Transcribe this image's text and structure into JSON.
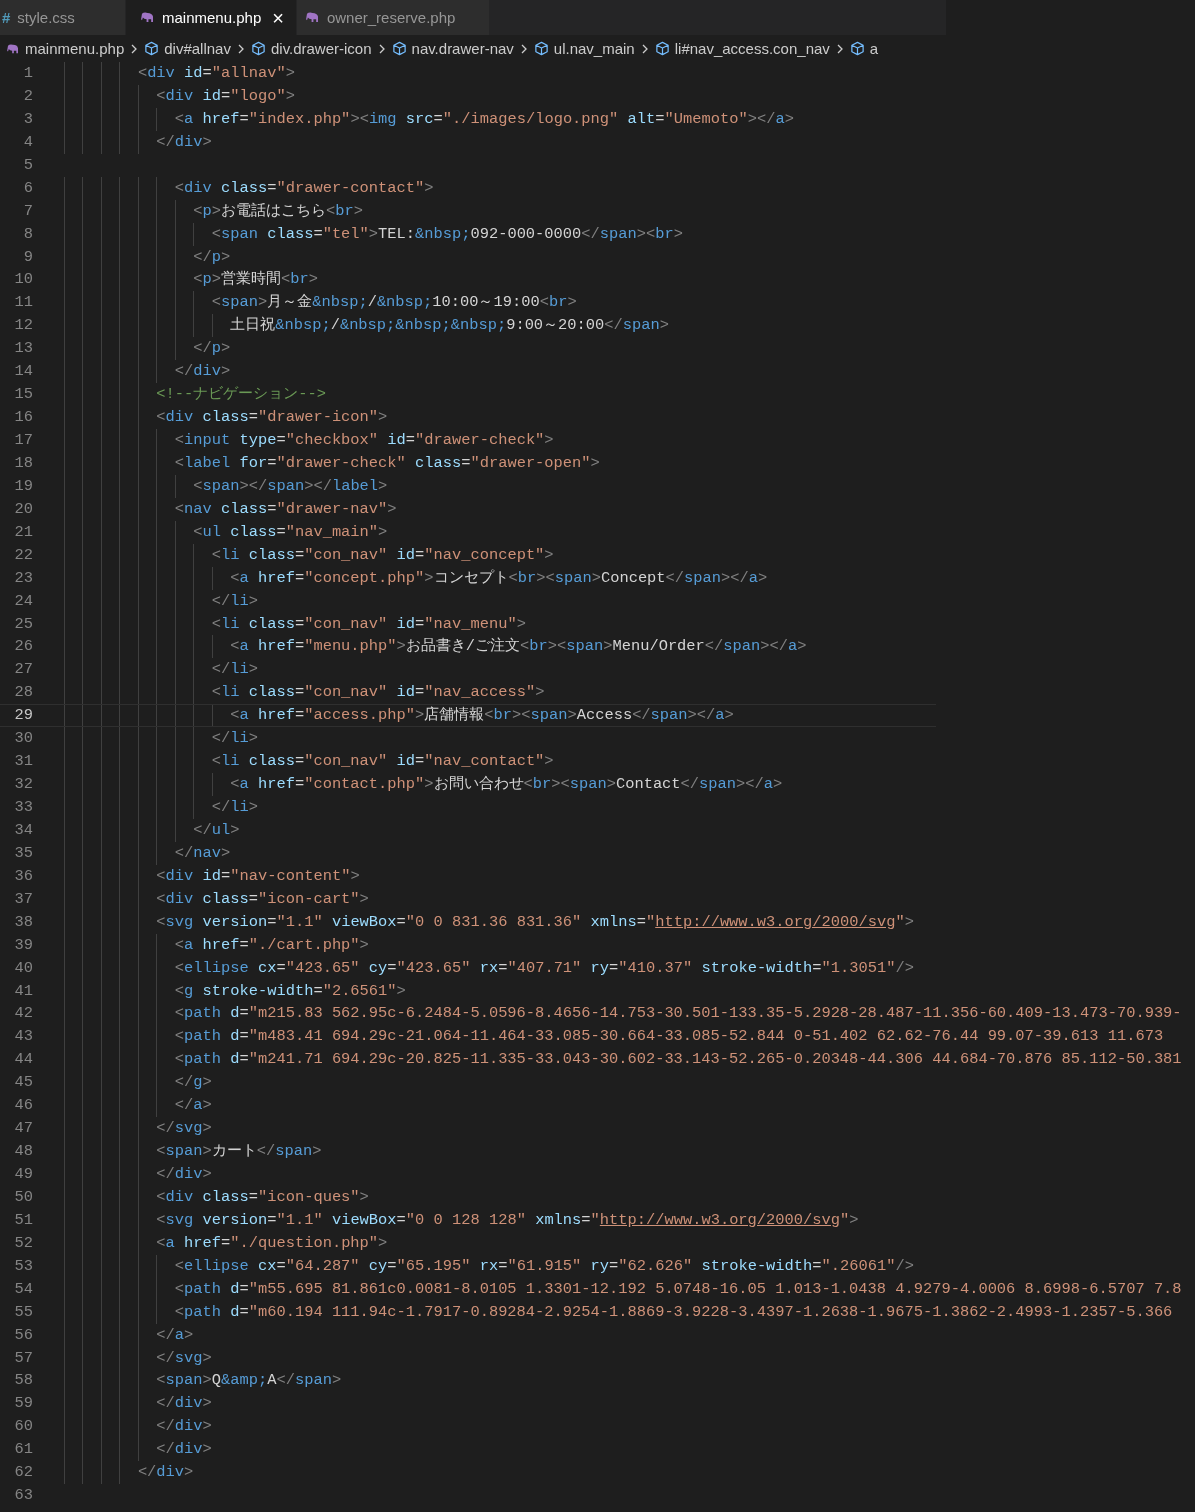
{
  "tabs": [
    {
      "label": "style.css",
      "kind": "css",
      "icon": "#",
      "selected": false
    },
    {
      "label": "mainmenu.php",
      "kind": "php",
      "selected": true,
      "close": "×"
    },
    {
      "label": "owner_reserve.php",
      "kind": "php",
      "selected": false
    }
  ],
  "breadcrumbs": [
    {
      "label": "mainmenu.php",
      "kind": "file"
    },
    {
      "label": "div#allnav",
      "kind": "element"
    },
    {
      "label": "div.drawer-icon",
      "kind": "element"
    },
    {
      "label": "nav.drawer-nav",
      "kind": "element"
    },
    {
      "label": "ul.nav_main",
      "kind": "element"
    },
    {
      "label": "li#nav_access.con_nav",
      "kind": "element"
    },
    {
      "label": "a",
      "kind": "element"
    }
  ],
  "lines": [
    {
      "number": "1",
      "current": false,
      "code": "        <div id=\"allnav\">"
    },
    {
      "number": "2",
      "current": false,
      "code": "          <div id=\"logo\">"
    },
    {
      "number": "3",
      "current": false,
      "code": "            <a href=\"index.php\"><img src=\"./images/logo.png\" alt=\"Umemoto\"></a>"
    },
    {
      "number": "4",
      "current": false,
      "code": "          </div>"
    },
    {
      "number": "5",
      "current": false
    },
    {
      "number": "6",
      "current": false,
      "code": "            <div class=\"drawer-contact\">"
    },
    {
      "number": "7",
      "current": false,
      "code": "              <p>お電話はこちら<br>"
    },
    {
      "number": "8",
      "current": false,
      "code": "                <span class=\"tel\">TEL:&nbsp;092-000-0000</span><br>"
    },
    {
      "number": "9",
      "current": false,
      "code": "              </p>"
    },
    {
      "number": "10",
      "current": false,
      "code": "              <p>営業時間<br>"
    },
    {
      "number": "11",
      "current": false,
      "code": "                <span>月～金&nbsp;/&nbsp;10:00～19:00<br>"
    },
    {
      "number": "12",
      "current": false,
      "code": "                  土日祝&nbsp;/&nbsp;&nbsp;&nbsp;9:00～20:00</span>"
    },
    {
      "number": "13",
      "current": false,
      "code": "              </p>"
    },
    {
      "number": "14",
      "current": false,
      "code": "            </div>"
    },
    {
      "number": "15",
      "current": false,
      "code": "          <!--ナビゲーション-->"
    },
    {
      "number": "16",
      "current": false,
      "code": "          <div class=\"drawer-icon\">"
    },
    {
      "number": "17",
      "current": false,
      "code": "            <input type=\"checkbox\" id=\"drawer-check\">"
    },
    {
      "number": "18",
      "current": false,
      "code": "            <label for=\"drawer-check\" class=\"drawer-open\">"
    },
    {
      "number": "19",
      "current": false,
      "code": "              <span></span></label>"
    },
    {
      "number": "20",
      "current": false,
      "code": "            <nav class=\"drawer-nav\">"
    },
    {
      "number": "21",
      "current": false,
      "code": "              <ul class=\"nav_main\">"
    },
    {
      "number": "22",
      "current": false,
      "code": "                <li class=\"con_nav\" id=\"nav_concept\">"
    },
    {
      "number": "23",
      "current": false,
      "code": "                  <a href=\"concept.php\">コンセプト<br><span>Concept</span></a>"
    },
    {
      "number": "24",
      "current": false,
      "code": "                </li>"
    },
    {
      "number": "25",
      "current": false,
      "code": "                <li class=\"con_nav\" id=\"nav_menu\">"
    },
    {
      "number": "26",
      "current": false,
      "code": "                  <a href=\"menu.php\">お品書き/ご注文<br><span>Menu/Order</span></a>"
    },
    {
      "number": "27",
      "current": false,
      "code": "                </li>"
    },
    {
      "number": "28",
      "current": false,
      "code": "                <li class=\"con_nav\" id=\"nav_access\">"
    },
    {
      "number": "29",
      "current": true,
      "code": "                  <a href=\"access.php\">店舗情報<br><span>Access</span></a>"
    },
    {
      "number": "30",
      "current": false,
      "code": "                </li>"
    },
    {
      "number": "31",
      "current": false,
      "code": "                <li class=\"con_nav\" id=\"nav_contact\">"
    },
    {
      "number": "32",
      "current": false,
      "code": "                  <a href=\"contact.php\">お問い合わせ<br><span>Contact</span></a>"
    },
    {
      "number": "33",
      "current": false,
      "code": "                </li>"
    },
    {
      "number": "34",
      "current": false,
      "code": "              </ul>"
    },
    {
      "number": "35",
      "current": false,
      "code": "            </nav>"
    },
    {
      "number": "36",
      "current": false,
      "code": "          <div id=\"nav-content\">"
    },
    {
      "number": "37",
      "current": false,
      "code": "          <div class=\"icon-cart\">"
    },
    {
      "number": "38",
      "current": false,
      "code": "          <svg version=\"1.1\" viewBox=\"0 0 831.36 831.36\" xmlns=\"http://www.w3.org/2000/svg\">"
    },
    {
      "number": "39",
      "current": false,
      "code": "            <a href=\"./cart.php\">"
    },
    {
      "number": "40",
      "current": false,
      "code": "            <ellipse cx=\"423.65\" cy=\"423.65\" rx=\"407.71\" ry=\"410.37\" stroke-width=\"1.3051\"/>"
    },
    {
      "number": "41",
      "current": false,
      "code": "            <g stroke-width=\"2.6561\">"
    },
    {
      "number": "42",
      "current": false,
      "code": "            <path d=\"m215.83 562.95c-6.2484-5.0596-8.4656-14.753-30.501-133.35-5.2928-28.487-11.356-60.409-13.473-70.939-"
    },
    {
      "number": "43",
      "current": false,
      "code": "            <path d=\"m483.41 694.29c-21.064-11.464-33.085-30.664-33.085-52.844 0-51.402 62.62-76.44 99.07-39.613 11.673"
    },
    {
      "number": "44",
      "current": false,
      "code": "            <path d=\"m241.71 694.29c-20.825-11.335-33.043-30.602-33.143-52.265-0.20348-44.306 44.684-70.876 85.112-50.381"
    },
    {
      "number": "45",
      "current": false,
      "code": "            </g>"
    },
    {
      "number": "46",
      "current": false,
      "code": "            </a>"
    },
    {
      "number": "47",
      "current": false,
      "code": "          </svg>"
    },
    {
      "number": "48",
      "current": false,
      "code": "          <span>カート</span>"
    },
    {
      "number": "49",
      "current": false,
      "code": "          </div>"
    },
    {
      "number": "50",
      "current": false,
      "code": "          <div class=\"icon-ques\">"
    },
    {
      "number": "51",
      "current": false,
      "code": "          <svg version=\"1.1\" viewBox=\"0 0 128 128\" xmlns=\"http://www.w3.org/2000/svg\">"
    },
    {
      "number": "52",
      "current": false,
      "code": "          <a href=\"./question.php\">"
    },
    {
      "number": "53",
      "current": false,
      "code": "            <ellipse cx=\"64.287\" cy=\"65.195\" rx=\"61.915\" ry=\"62.626\" stroke-width=\".26061\"/>"
    },
    {
      "number": "54",
      "current": false,
      "code": "            <path d=\"m55.695 81.861c0.0081-8.0105 1.3301-12.192 5.0748-16.05 1.013-1.0438 4.9279-4.0006 8.6998-6.5707 7.8"
    },
    {
      "number": "55",
      "current": false,
      "code": "            <path d=\"m60.194 111.94c-1.7917-0.89284-2.9254-1.8869-3.9228-3.4397-1.2638-1.9675-1.3862-2.4993-1.2357-5.366"
    },
    {
      "number": "56",
      "current": false,
      "code": "          </a>"
    },
    {
      "number": "57",
      "current": false,
      "code": "          </svg>"
    },
    {
      "number": "58",
      "current": false,
      "code": "          <span>Q&amp;A</span>"
    },
    {
      "number": "59",
      "current": false,
      "code": "          </div>"
    },
    {
      "number": "60",
      "current": false,
      "code": "          </div>"
    },
    {
      "number": "61",
      "current": false,
      "code": "          </div>"
    },
    {
      "number": "62",
      "current": false,
      "code": "        </div>"
    },
    {
      "number": "63",
      "current": false
    }
  ]
}
